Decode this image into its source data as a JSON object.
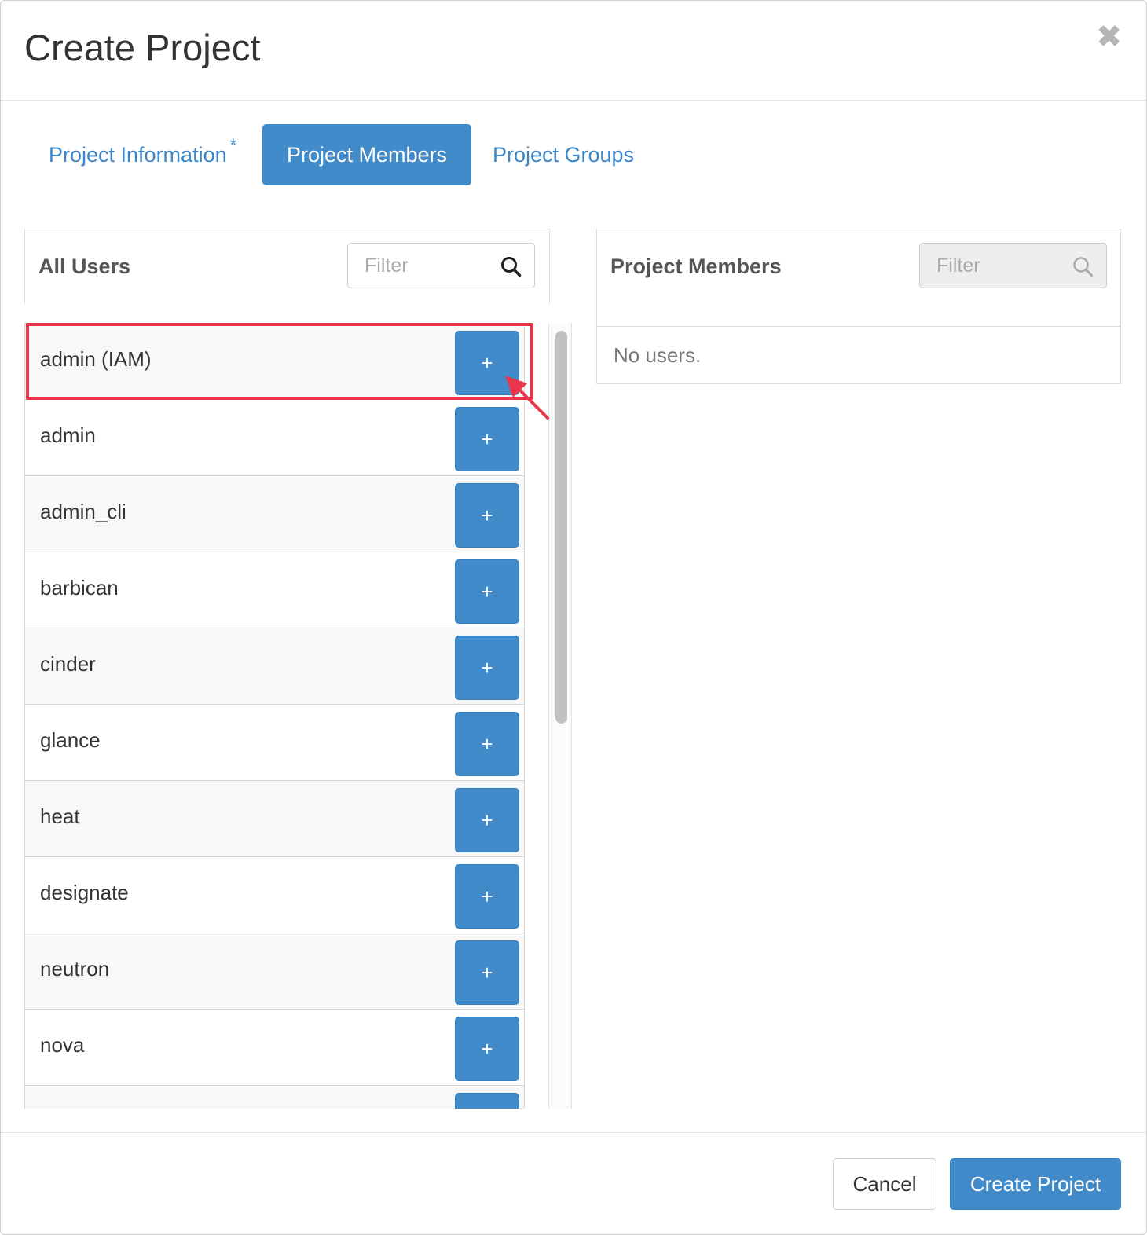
{
  "dialog": {
    "title": "Create Project",
    "close_glyph": "✖"
  },
  "tabs": [
    {
      "label": "Project Information",
      "required_mark": "*",
      "active": false
    },
    {
      "label": "Project Members",
      "active": true
    },
    {
      "label": "Project Groups",
      "active": false
    }
  ],
  "all_users": {
    "title": "All Users",
    "filter_placeholder": "Filter",
    "add_label": "+",
    "users": [
      "admin (IAM)",
      "admin",
      "admin_cli",
      "barbican",
      "cinder",
      "glance",
      "heat",
      "designate",
      "neutron",
      "nova",
      ""
    ]
  },
  "project_members": {
    "title": "Project Members",
    "filter_placeholder": "Filter",
    "empty_text": "No users."
  },
  "footer": {
    "cancel_label": "Cancel",
    "create_label": "Create Project"
  },
  "annotation": {
    "highlight_color": "#e8374a",
    "highlighted_user": "admin (IAM)"
  },
  "colors": {
    "primary": "#428bca",
    "link": "#3a86c8"
  }
}
